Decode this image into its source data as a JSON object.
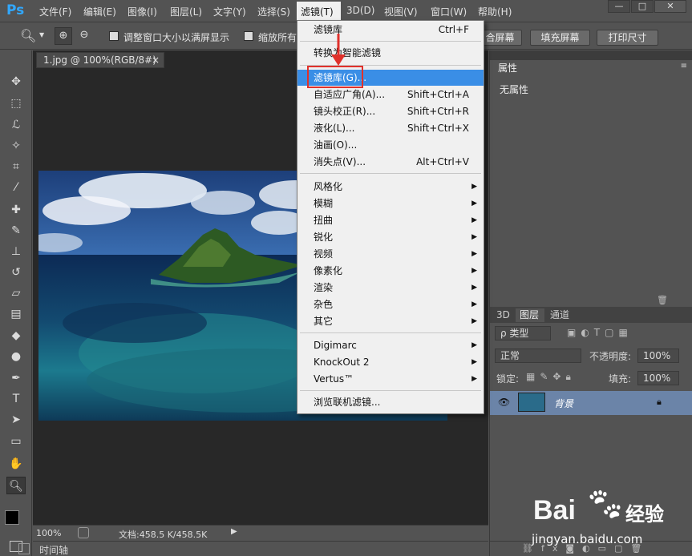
{
  "app": {
    "logo": "Ps"
  },
  "menubar": {
    "items": [
      "文件(F)",
      "编辑(E)",
      "图像(I)",
      "图层(L)",
      "文字(Y)",
      "选择(S)",
      "滤镜(T)",
      "3D(D)",
      "视图(V)",
      "窗口(W)",
      "帮助(H)"
    ],
    "active_index": 6
  },
  "window_controls": {
    "minimize": "—",
    "restore": "□",
    "close": "✕"
  },
  "optionsbar": {
    "checkbox1_label": "调整窗口大小以满屏显示",
    "checkbox2_label": "缩放所有",
    "btn_fit": "合屏幕",
    "btn_fill": "填充屏幕",
    "btn_print": "打印尺寸"
  },
  "document": {
    "tab_title": "1.jpg @ 100%(RGB/8#)",
    "tab_close": "×",
    "zoom": "100%",
    "doc_info": "文档:458.5 K/458.5K",
    "timeline_label": "时间轴"
  },
  "filter_menu": {
    "top_items": [
      {
        "label": "滤镜库",
        "shortcut": "Ctrl+F"
      }
    ],
    "smart": "转换为智能滤镜",
    "group1": [
      {
        "label": "滤镜库(G)...",
        "shortcut": ""
      },
      {
        "label": "自适应广角(A)...",
        "shortcut": "Shift+Ctrl+A"
      },
      {
        "label": "镜头校正(R)...",
        "shortcut": "Shift+Ctrl+R"
      },
      {
        "label": "液化(L)...",
        "shortcut": "Shift+Ctrl+X"
      },
      {
        "label": "油画(O)...",
        "shortcut": ""
      },
      {
        "label": "消失点(V)...",
        "shortcut": "Alt+Ctrl+V"
      }
    ],
    "group2": [
      "风格化",
      "模糊",
      "扭曲",
      "锐化",
      "视频",
      "像素化",
      "渲染",
      "杂色",
      "其它"
    ],
    "group3": [
      "Digimarc",
      "KnockOut 2",
      "Vertus™"
    ],
    "browse": "浏览联机滤镜..."
  },
  "properties_panel": {
    "tab": "属性",
    "content": "无属性"
  },
  "layers_panel": {
    "tabs": [
      "3D",
      "图层",
      "通道"
    ],
    "active_tab": 1,
    "filter_kind": "ρ 类型",
    "blend_mode": "正常",
    "opacity_label": "不透明度:",
    "opacity_value": "100%",
    "lock_label": "锁定:",
    "fill_label": "填充:",
    "fill_value": "100%",
    "layers": [
      {
        "name": "背景",
        "locked": true
      }
    ]
  },
  "watermark": {
    "brand": "Bai",
    "brand2": "经验",
    "url": "jingyan.baidu.com"
  },
  "colors": {
    "accent": "#31a8ff",
    "highlight": "#3a8ee6",
    "redbox": "#e0312b"
  }
}
